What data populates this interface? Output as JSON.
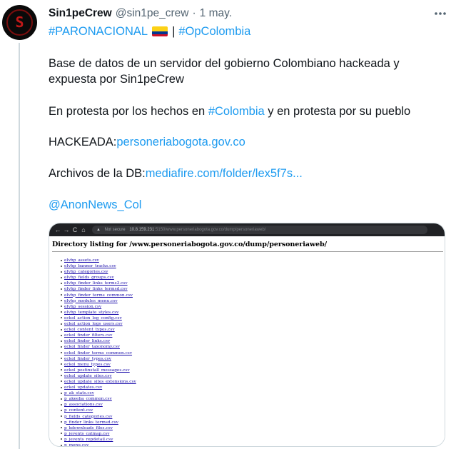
{
  "author": {
    "name": "Sin1peCrew",
    "handle": "@sin1pe_crew",
    "separator": "·",
    "date": "1 may.",
    "avatar_glyph": "S"
  },
  "more_icon": "more-horizontal-icon",
  "hashtags": {
    "first": "#PARONACIONAL",
    "flag": "colombia-flag",
    "separator": "|",
    "second": "#OpColombia"
  },
  "body": {
    "p1": "Base de datos de un servidor del gobierno Colombiano hackeada y expuesta por Sin1peCrew",
    "p2_before": "En protesta por los hechos en ",
    "p2_link": "#Colombia",
    "p2_after": " y en protesta por su pueblo",
    "p3_label": "HACKEADA:",
    "p3_link": "personeriabogota.gov.co",
    "p4_label": "Archivos de la DB:",
    "p4_link": "mediafire.com/folder/lex5f7s...",
    "mention": "@AnonNews_Col"
  },
  "screenshot": {
    "nav_back": "←",
    "nav_forward": "→",
    "nav_reload": "C",
    "nav_home": "⌂",
    "address_security": "Not secure",
    "address_ip": "10.8.159.231",
    "address_path": ":5150/www.personeriabogota.gov.co/dump/personeriaweb/",
    "title": "Directory listing for /www.personeriabogota.gov.co/dump/personeriaweb/",
    "files": [
      "eIvhp_assets.csv",
      "eIvhp_banner_tracks.csv",
      "eIvhp_categories.csv",
      "eIvhp_fields_groups.csv",
      "eIvhp_finder_links_terms3.csv",
      "eIvhp_finder_links_termsd.csv",
      "eIvhp_finder_terms_common.csv",
      "eIvhp_modules_menu.csv",
      "eIvhp_session.csv",
      "eIvhp_template_styles.csv",
      "eckol_action_log_config.csv",
      "eckol_action_logs_users.csv",
      "eckol_content_types.csv",
      "eckol_finder_filters.csv",
      "eckol_finder_links.csv",
      "eckol_finder_taxonomy.csv",
      "eckol_finder_terms_common.csv",
      "eckol_finder_types.csv",
      "eckol_menu_types.csv",
      "eckol_postinstall_messages.csv",
      "eckol_update_sites.csv",
      "eckol_update_sites_extensions.csv",
      "eckol_updates.csv",
      "p_ak_stats.csv",
      "p_akeeba_common.csv",
      "p_associations.csv",
      "p_content.csv",
      "p_fields_categories.csv",
      "p_finder_links_termsd.csv",
      "p_kdownloads_files.csv",
      "p_jevents_catmap.csv",
      "p_jevents_repdetail.csv",
      "p_menu.csv"
    ]
  }
}
